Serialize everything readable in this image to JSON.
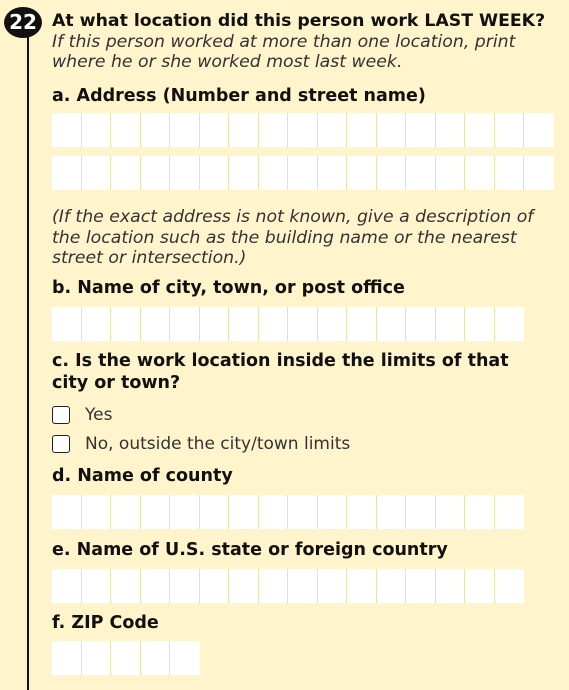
{
  "question": {
    "number": "22",
    "title": "At what location did this person work LAST WEEK?",
    "instruction": "If this person worked at more than one location, print where he or she worked most last week."
  },
  "parts": {
    "a": {
      "label": "a. Address (Number and street name)"
    },
    "note": "(If the exact address is not known, give a description of the location such as the building name or the nearest street or intersection.)",
    "b": {
      "label": "b. Name of city, town, or post office"
    },
    "c": {
      "label": "c. Is the work location inside the limits of that city or town?",
      "options": [
        {
          "label": "Yes",
          "checked": false
        },
        {
          "label": "No, outside the city/town limits",
          "checked": false
        }
      ]
    },
    "d": {
      "label": "d. Name of county"
    },
    "e": {
      "label": "e. Name of U.S. state or foreign country"
    },
    "f": {
      "label": "f. ZIP Code"
    }
  },
  "colors": {
    "background": "#fff4cc",
    "entry_field": "#ffffff",
    "box_divider": "#f5deae",
    "question_badge": "#111111"
  }
}
